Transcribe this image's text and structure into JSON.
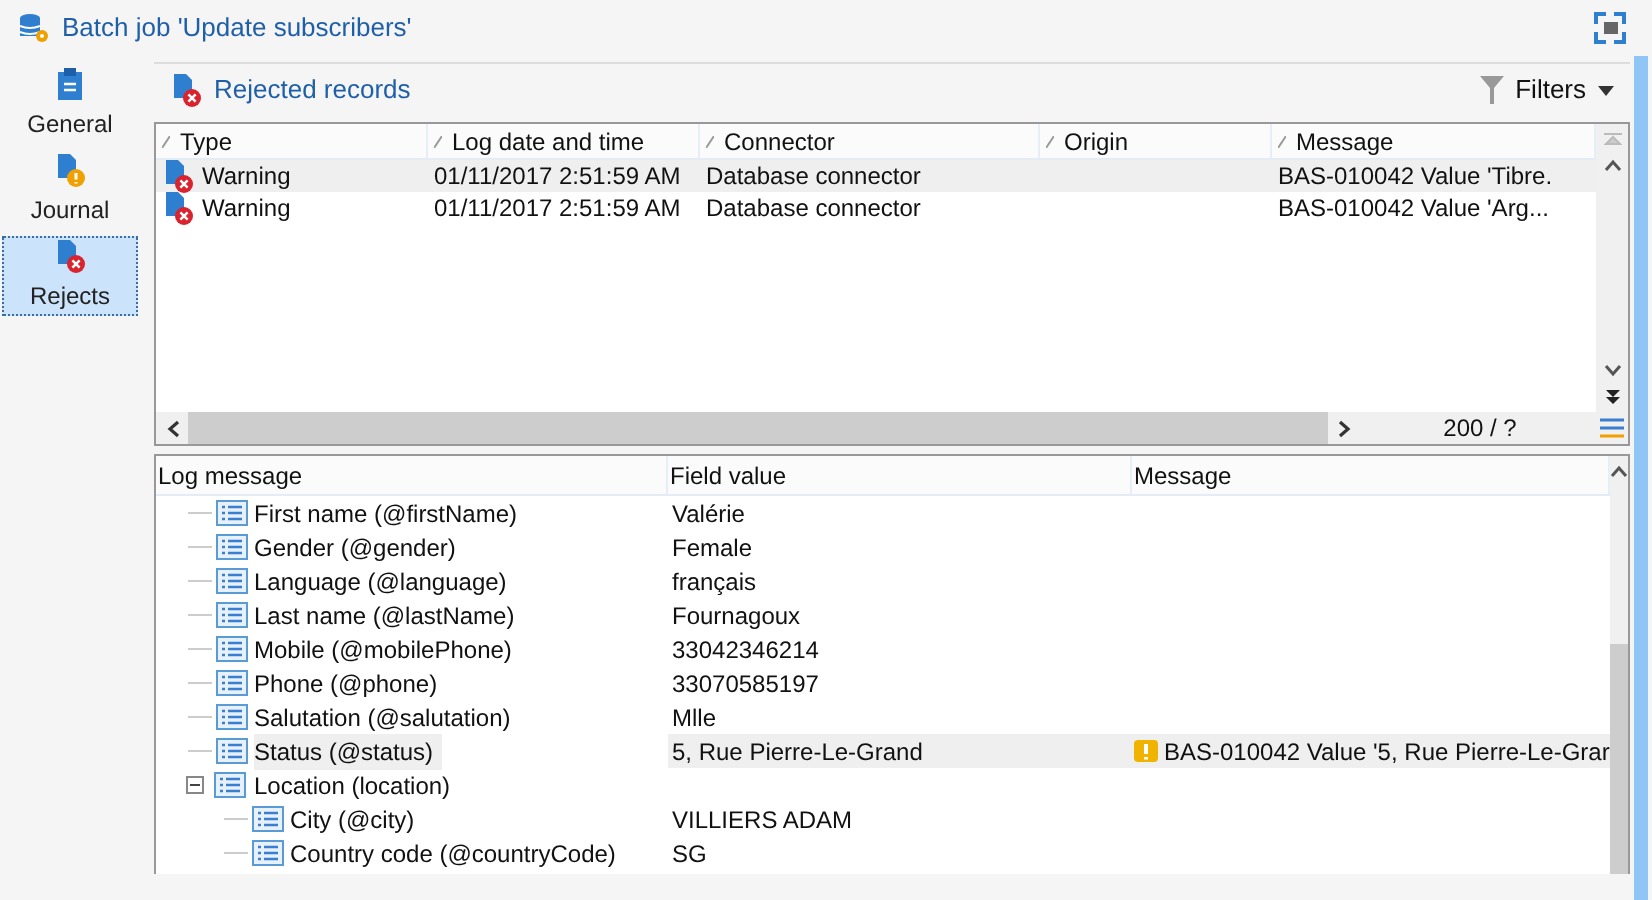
{
  "window": {
    "title": "Batch job 'Update subscribers'"
  },
  "sidebar": {
    "items": [
      {
        "label": "General",
        "kind": "general",
        "selected": false
      },
      {
        "label": "Journal",
        "kind": "journal",
        "selected": false
      },
      {
        "label": "Rejects",
        "kind": "rejects",
        "selected": true
      }
    ]
  },
  "toolbar": {
    "title": "Rejected records",
    "filters": "Filters"
  },
  "rejects_table": {
    "columns": [
      "Type",
      "Log date and time",
      "Connector",
      "Origin",
      "Message"
    ],
    "rows": [
      {
        "type": "Warning",
        "date": "01/11/2017 2:51:59 AM",
        "connector": "Database connector",
        "origin": "",
        "message": "BAS-010042 Value 'Tibre.",
        "selected": true
      },
      {
        "type": "Warning",
        "date": "01/11/2017 2:51:59 AM",
        "connector": "Database connector",
        "origin": "",
        "message": "BAS-010042 Value 'Arg...",
        "selected": false
      }
    ],
    "count": "200 / ?"
  },
  "detail_tree": {
    "columns": [
      "Log message",
      "Field value",
      "Message"
    ],
    "items": [
      {
        "label": "First name (@firstName)",
        "value": "Valérie",
        "selected": false
      },
      {
        "label": "Gender (@gender)",
        "value": "Female",
        "selected": false
      },
      {
        "label": "Language (@language)",
        "value": "français",
        "selected": false
      },
      {
        "label": "Last name (@lastName)",
        "value": "Fournagoux",
        "selected": false
      },
      {
        "label": "Mobile (@mobilePhone)",
        "value": "33042346214",
        "selected": false
      },
      {
        "label": "Phone (@phone)",
        "value": "33070585197",
        "selected": false
      },
      {
        "label": "Salutation (@salutation)",
        "value": "Mlle",
        "selected": false
      },
      {
        "label": "Status (@status)",
        "value": "5, Rue Pierre-Le-Grand",
        "message": "BAS-010042 Value '5, Rue Pierre-Le-Grar",
        "selected": true
      },
      {
        "label": "Location (location)",
        "selected": false,
        "expanded": true,
        "children": [
          {
            "label": "City (@city)",
            "value": "VILLIERS ADAM",
            "selected": false
          },
          {
            "label": "Country code (@countryCode)",
            "value": "SG",
            "selected": false
          }
        ]
      }
    ]
  }
}
